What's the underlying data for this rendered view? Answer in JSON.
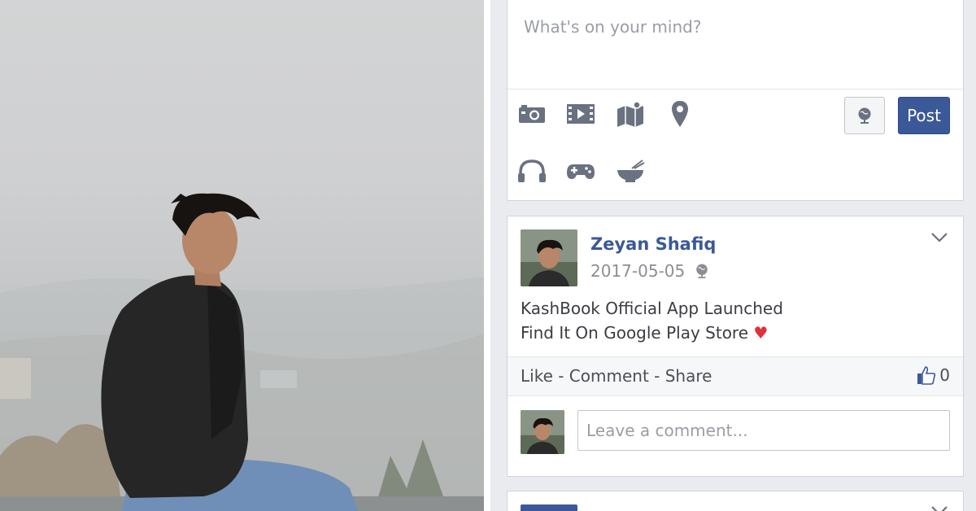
{
  "composer": {
    "placeholder": "What's on your mind?",
    "tools_row1": [
      "camera-icon",
      "video-icon",
      "map-icon",
      "location-pin-icon"
    ],
    "tools_row2": [
      "headphones-icon",
      "gamepad-icon",
      "food-bowl-icon"
    ],
    "privacy_icon": "globe-icon",
    "post_label": "Post"
  },
  "post": {
    "author": "Zeyan Shafiq",
    "date": "2017-05-05",
    "privacy_icon": "globe-icon",
    "text_line1": "KashBook Official App Launched",
    "text_line2": "Find It On Google Play Store",
    "emoji": "♥",
    "actions": "Like - Comment - Share",
    "like_count": "0",
    "comment_placeholder": "Leave a comment..."
  },
  "colors": {
    "brand": "#3b5998",
    "feed_bg": "#e9ebee",
    "heart": "#e0303a"
  }
}
